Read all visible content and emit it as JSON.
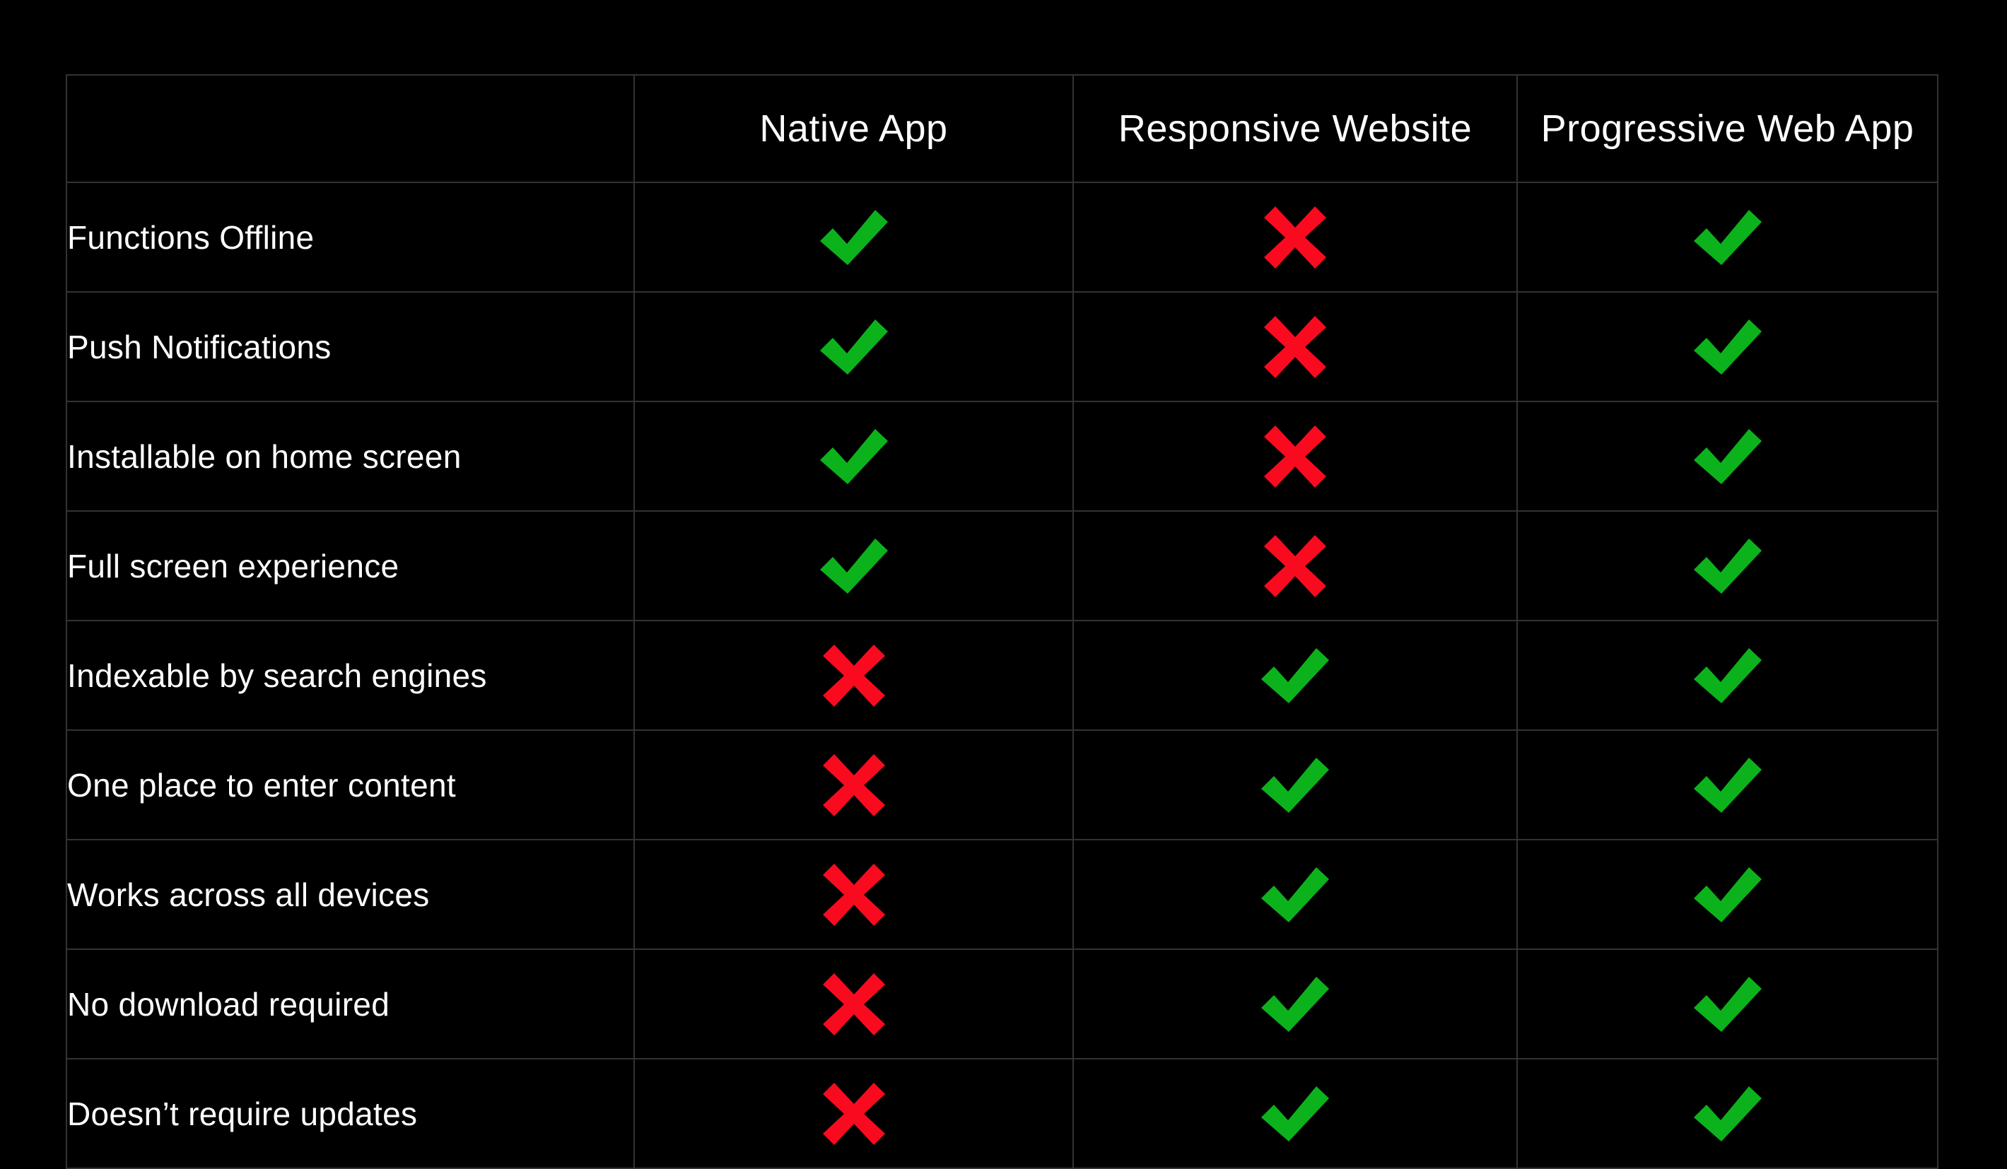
{
  "table": {
    "corner_label": "",
    "columns": [
      {
        "key": "native",
        "label": "Native App",
        "highlighted": false
      },
      {
        "key": "responsive",
        "label": "Responsive Website",
        "highlighted": false
      },
      {
        "key": "pwa",
        "label": "Progressive Web App",
        "highlighted": true
      }
    ],
    "rows": [
      {
        "feature": "Functions Offline",
        "values": [
          "yes",
          "no",
          "yes"
        ]
      },
      {
        "feature": "Push Notifications",
        "values": [
          "yes",
          "no",
          "yes"
        ]
      },
      {
        "feature": "Installable on home screen",
        "values": [
          "yes",
          "no",
          "yes"
        ]
      },
      {
        "feature": "Full screen experience",
        "values": [
          "yes",
          "no",
          "yes"
        ]
      },
      {
        "feature": "Indexable by search engines",
        "values": [
          "no",
          "yes",
          "yes"
        ]
      },
      {
        "feature": "One place to enter content",
        "values": [
          "no",
          "yes",
          "yes"
        ]
      },
      {
        "feature": "Works across all devices",
        "values": [
          "no",
          "yes",
          "yes"
        ]
      },
      {
        "feature": "No download required",
        "values": [
          "no",
          "yes",
          "yes"
        ]
      },
      {
        "feature": "Doesn’t require updates",
        "values": [
          "no",
          "yes",
          "yes"
        ]
      }
    ]
  },
  "icons": {
    "yes": "check-icon",
    "no": "cross-icon"
  },
  "colors": {
    "page_background": "#000000",
    "cell_background": "#000000",
    "highlight_column_background": "#161616",
    "border": "#333333",
    "text": "#ffffff",
    "check_green": "#0CB21C",
    "cross_red": "#FA0A1E"
  }
}
